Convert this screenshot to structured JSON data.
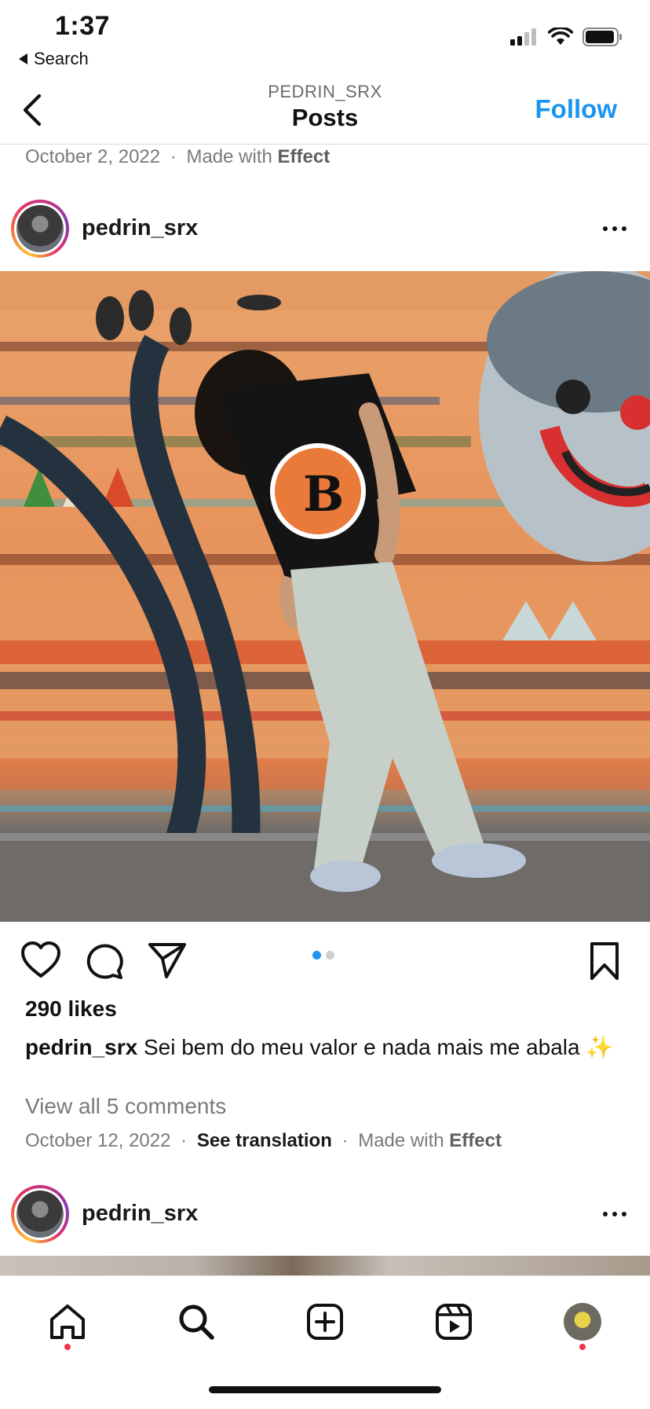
{
  "status_bar": {
    "time": "1:37",
    "back_label": "Search"
  },
  "nav": {
    "subtitle": "PEDRIN_SRX",
    "title": "Posts",
    "follow_label": "Follow"
  },
  "prev_post_meta": {
    "date": "October 2, 2022",
    "sep": "·",
    "made_with": "Made with",
    "effect": "Effect"
  },
  "post": {
    "username": "pedrin_srx",
    "likes": "290 likes",
    "caption_user": "pedrin_srx",
    "caption_text": "Sei bem do meu valor e nada mais me abala ✨",
    "view_comments": "View all 5 comments",
    "date": "October 12, 2022",
    "sep": "·",
    "see_translation": "See translation",
    "made_with": "Made with",
    "effect": "Effect",
    "carousel": {
      "count": 2,
      "active": 1
    }
  },
  "next_post": {
    "username": "pedrin_srx"
  },
  "tabbar": {
    "items": [
      "home-tab",
      "search-tab",
      "create-tab",
      "reels-tab",
      "profile-tab"
    ]
  },
  "colors": {
    "accent": "#1b95f0",
    "notification": "#f0334b"
  },
  "icons": [
    "chevron-left-icon",
    "heart-icon",
    "comment-icon",
    "send-icon",
    "bookmark-icon",
    "more-icon",
    "home-icon",
    "search-icon",
    "add-icon",
    "reels-icon"
  ]
}
